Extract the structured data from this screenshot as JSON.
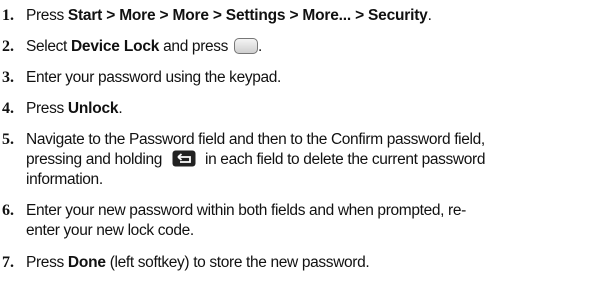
{
  "steps": [
    {
      "number": "1.",
      "text_1": "Press ",
      "bold_1": "Start > More > More > Settings > More... > Security",
      "text_2": "."
    },
    {
      "number": "2.",
      "text_1": "Select ",
      "bold_1": "Device Lock",
      "text_2": " and press ",
      "icon": "center-key-button-icon",
      "text_3": "."
    },
    {
      "number": "3.",
      "text_1": "Enter your password using the keypad."
    },
    {
      "number": "4.",
      "text_1": "Press ",
      "bold_1": "Unlock",
      "text_2": "."
    },
    {
      "number": "5.",
      "line_1": "Navigate to the Password field and then to the Confirm password field,",
      "line_2a": "pressing and holding ",
      "icon": "back-key-icon",
      "line_2b": " in each field to delete the current password",
      "line_3": "information."
    },
    {
      "number": "6.",
      "line_1": "Enter your new password within both fields and when prompted, re-",
      "line_2": "enter your new lock code."
    },
    {
      "number": "7.",
      "text_1": "Press ",
      "bold_1": "Done",
      "text_2": " (left softkey) to store the new password."
    }
  ]
}
